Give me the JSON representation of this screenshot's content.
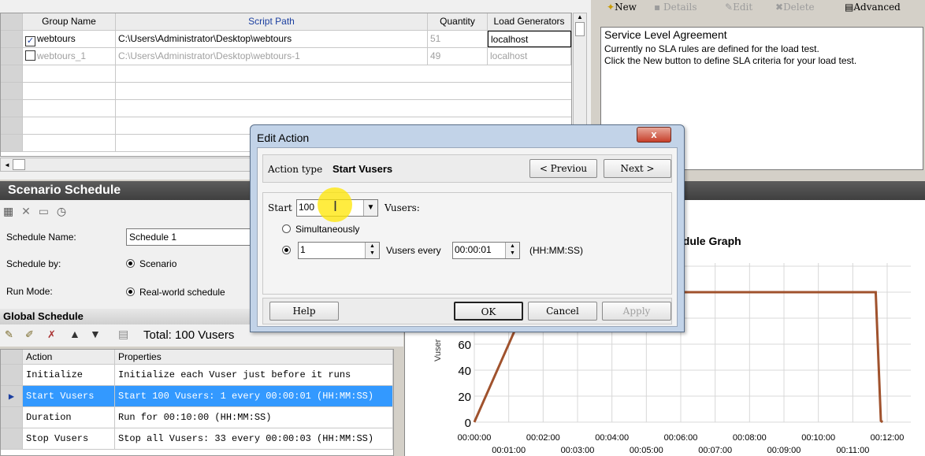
{
  "load_test_grid": {
    "headers": [
      "Group Name",
      "Script Path",
      "Quantity",
      "Load Generators"
    ],
    "rows": [
      {
        "checked": true,
        "group": "webtours",
        "path": "C:\\Users\\Administrator\\Desktop\\webtours",
        "quantity": "51",
        "generator": "localhost"
      },
      {
        "checked": false,
        "group": "webtours_1",
        "path": "C:\\Users\\Administrator\\Desktop\\webtours-1",
        "quantity": "49",
        "generator": "localhost"
      }
    ]
  },
  "sla": {
    "toolbar": {
      "new": "New",
      "details": "Details",
      "edit": "Edit",
      "delete": "Delete",
      "advanced": "Advanced"
    },
    "title": "Service Level Agreement",
    "line1": "Currently no SLA rules are defined for the load test.",
    "line2": "Click the New button to define SLA criteria for your load test."
  },
  "scenario_schedule": {
    "header": "Scenario Schedule",
    "schedule_name_label": "Schedule Name:",
    "schedule_name_value": "Schedule 1",
    "schedule_by_label": "Schedule by:",
    "schedule_by_value": "Scenario",
    "run_mode_label": "Run Mode:",
    "run_mode_value": "Real-world schedule"
  },
  "global_schedule": {
    "header": "Global Schedule",
    "total": "Total: 100 Vusers",
    "headers": [
      "Action",
      "Properties"
    ],
    "rows": [
      {
        "action": "Initialize",
        "properties": "Initialize each Vuser just before it runs",
        "selected": false
      },
      {
        "action": "Start  Vusers",
        "properties": "Start 100 Vusers: 1 every 00:00:01 (HH:MM:SS)",
        "selected": true
      },
      {
        "action": "Duration",
        "properties": "Run for 00:10:00 (HH:MM:SS)",
        "selected": false
      },
      {
        "action": "Stop Vusers",
        "properties": "Stop all Vusers: 33 every 00:00:03 (HH:MM:SS)",
        "selected": false
      }
    ]
  },
  "graph": {
    "title": "edule Graph",
    "ylabel": "Vuser",
    "yticks": [
      "0",
      "20",
      "40",
      "60"
    ],
    "xticks_top": [
      "00:00:00",
      "00:02:00",
      "00:04:00",
      "00:06:00",
      "00:08:00",
      "00:10:00",
      "00:12:00"
    ],
    "xticks_bottom": [
      "00:01:00",
      "00:03:00",
      "00:05:00",
      "00:07:00",
      "00:09:00",
      "00:11:00"
    ]
  },
  "chart_data": {
    "type": "line",
    "ylabel": "Vuser",
    "x_unit": "seconds",
    "series": [
      {
        "x": [
          0,
          100,
          700,
          703,
          706,
          709,
          712
        ],
        "values": [
          0,
          100,
          100,
          67,
          34,
          1,
          0
        ]
      }
    ],
    "xlim": [
      0,
      720
    ],
    "color": "#a0522d"
  },
  "dialog": {
    "title": "Edit Action",
    "close": "x",
    "action_type_label": "Action type",
    "action_type_value": "Start Vusers",
    "previous": "< Previou",
    "next": "Next  >",
    "start_label": "Start",
    "start_value": "100",
    "vusers_label": "Vusers:",
    "simultaneously": "Simultaneously",
    "every_count": "1",
    "vusers_every": "Vusers every",
    "interval": "00:00:01",
    "interval_unit": "(HH:MM:SS)",
    "help": "Help",
    "ok": "OK",
    "cancel": "Cancel",
    "apply": "Apply"
  }
}
